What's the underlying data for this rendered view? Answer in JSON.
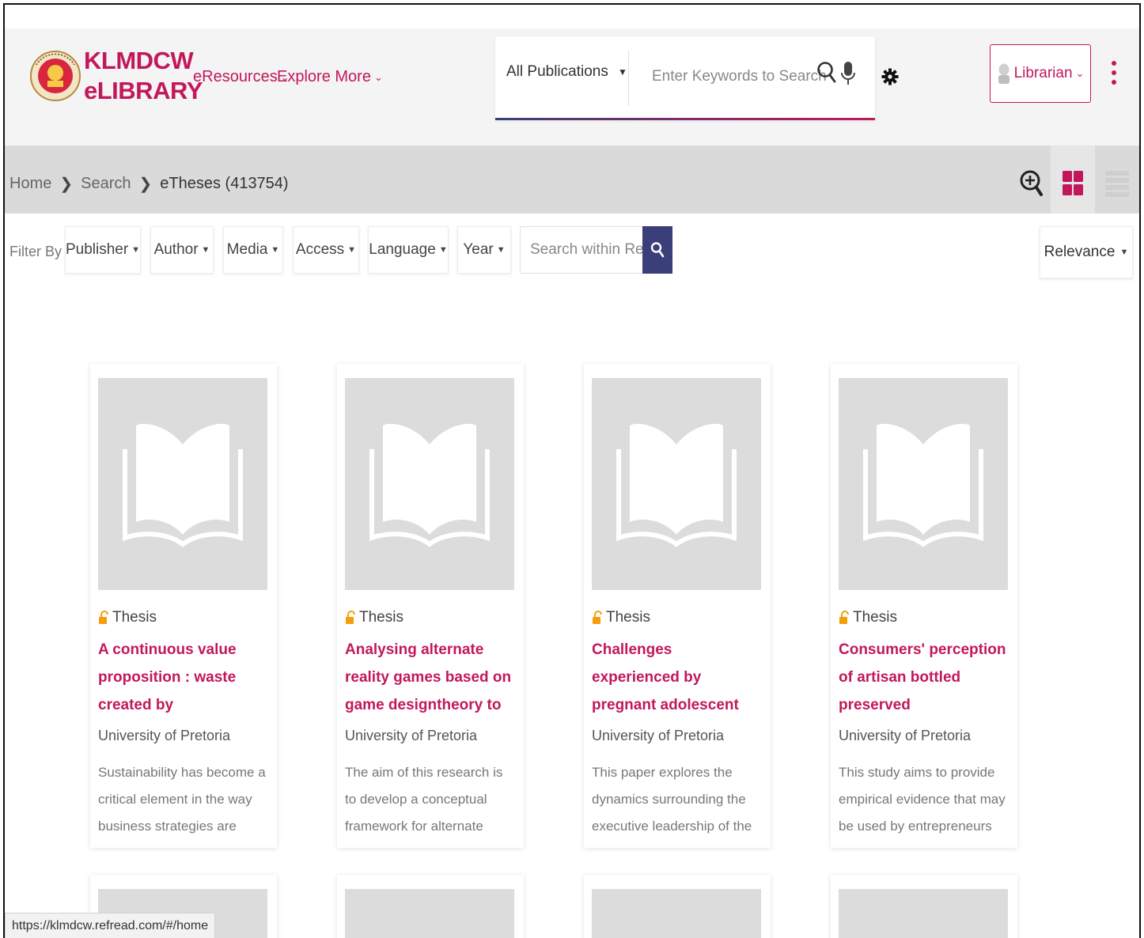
{
  "brand": {
    "line1": "KLMDCW",
    "line2": "eLIBRARY",
    "color": "#c2185b"
  },
  "nav": {
    "eresources": "eResources",
    "explore": "Explore More"
  },
  "search": {
    "scope": "All Publications",
    "placeholder": "Enter Keywords to Search"
  },
  "user": {
    "label": "Librarian"
  },
  "breadcrumb": {
    "home": "Home",
    "search": "Search",
    "current": "eTheses (413754)"
  },
  "filters": {
    "label": "Filter By :",
    "items": [
      "Publisher",
      "Author",
      "Media",
      "Access",
      "Language",
      "Year"
    ],
    "within_placeholder": "Search within Result",
    "sort": "Relevance"
  },
  "cards": [
    {
      "type": "Thesis",
      "title": "A continuous value proposition : waste created by foodmanufacturing",
      "publisher": "University of Pretoria",
      "desc": "Sustainability has become a critical element in the way business strategies are designed. Many"
    },
    {
      "type": "Thesis",
      "title": "Analysing alternate reality games based on game designtheory to propose a",
      "publisher": "University of Pretoria",
      "desc": "The aim of this research is to develop a conceptual framework for alternate reality games based"
    },
    {
      "type": "Thesis",
      "title": "Challenges experienced by pregnant adolescent learnersin a school setting",
      "publisher": "University of Pretoria",
      "desc": "This paper explores the dynamics surrounding the executive leadership of the African Union"
    },
    {
      "type": "Thesis",
      "title": "Consumers' perception of artisan bottled preserved foodproducts",
      "publisher": "University of Pretoria",
      "desc": "This study aims to provide empirical evidence that may be used by entrepreneurs who wish to"
    }
  ],
  "status_url": "https://klmdcw.refread.com/#/home",
  "colors": {
    "accent": "#c2185b",
    "navy": "#3a3f7a",
    "breadcrumb_bg": "#dadada",
    "cover_bg": "#dcdcdc"
  }
}
